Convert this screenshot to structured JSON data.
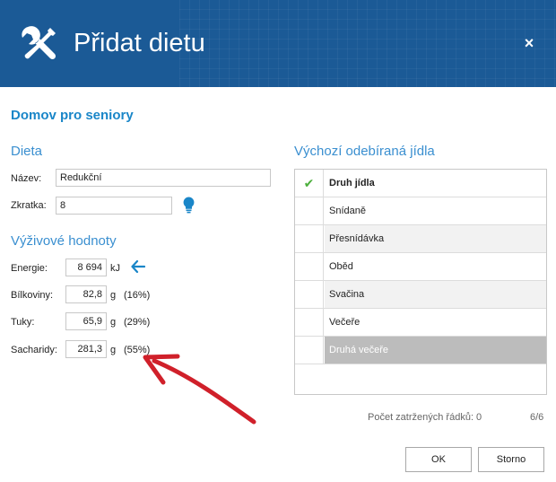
{
  "window": {
    "title": "Přidat dietu",
    "close_glyph": "×",
    "icon": "tools-icon",
    "accent": "#1b5a96"
  },
  "org_name": "Domov pro seniory",
  "dieta": {
    "heading": "Dieta",
    "name_label": "Název:",
    "name_value": "Redukční",
    "abbr_label": "Zkratka:",
    "abbr_value": "8",
    "hint_icon": "lightbulb-icon"
  },
  "nutrition": {
    "heading": "Výživové hodnoty",
    "rows": [
      {
        "label": "Energie:",
        "value": "8 694",
        "unit": "kJ",
        "pct": ""
      },
      {
        "label": "Bílkoviny:",
        "value": "82,8",
        "unit": "g",
        "pct": "(16%)"
      },
      {
        "label": "Tuky:",
        "value": "65,9",
        "unit": "g",
        "pct": "(29%)"
      },
      {
        "label": "Sacharidy:",
        "value": "281,3",
        "unit": "g",
        "pct": "(55%)"
      }
    ],
    "energy_arrow_icon": "arrow-left-icon"
  },
  "meals": {
    "heading": "Výchozí odebíraná jídla",
    "column_header": "Druh jídla",
    "header_check_icon": "checkmark-icon",
    "items": [
      "Snídaně",
      "Přesnídávka",
      "Oběd",
      "Svačina",
      "Večeře",
      "Druhá večeře"
    ],
    "selected_index": 5
  },
  "status": {
    "checked_rows": "Počet zatržených řádků: 0",
    "row_count": "6/6"
  },
  "buttons": {
    "ok": "OK",
    "cancel": "Storno"
  },
  "colors": {
    "heading": "#3a8fd0",
    "org": "#1a86c8",
    "annotation_arrow": "#d0202a",
    "hint": "#1a86c8"
  }
}
